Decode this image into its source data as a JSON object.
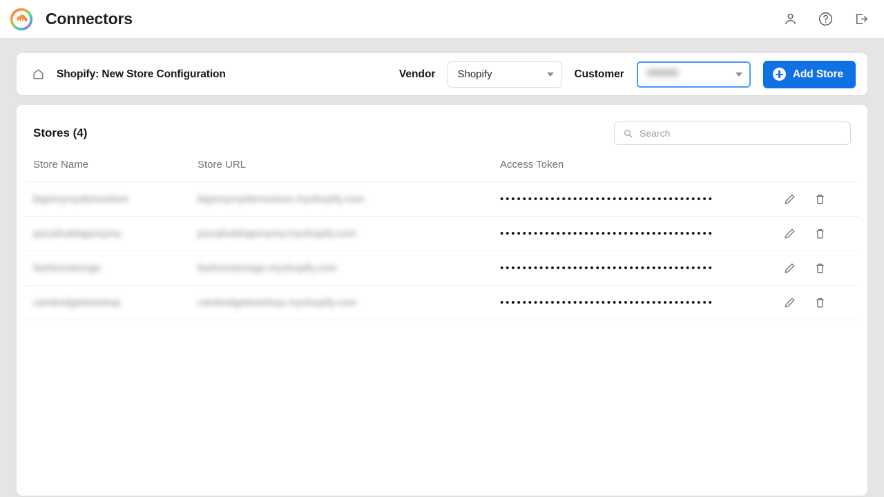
{
  "header": {
    "app_title": "Connectors",
    "logo_icon": "cloud-bar-chart-logo",
    "actions": [
      {
        "name": "account-icon",
        "label": "Account"
      },
      {
        "name": "help-icon",
        "label": "Help"
      },
      {
        "name": "logout-icon",
        "label": "Log out"
      }
    ]
  },
  "toolbar": {
    "home_icon": "home-icon",
    "config_title": "Shopify: New Store Configuration",
    "vendor_label": "Vendor",
    "vendor_value": "Shopify",
    "customer_label": "Customer",
    "customer_value": "default",
    "customer_focused": true,
    "add_store_label": "Add Store",
    "add_button_color": "#1071e5"
  },
  "stores": {
    "title": "Stores (4)",
    "count": 4,
    "search": {
      "placeholder": "Search",
      "value": "",
      "icon": "search-icon"
    },
    "columns": [
      "Store Name",
      "Store URL",
      "Access Token",
      ""
    ],
    "token_mask": "••••••••••••••••••••••••••••••••••••••",
    "rows": [
      {
        "store_name": "bigsmymydemostore",
        "store_url": "bigsmymydemostore.myshopify.com",
        "access_token": "••••••••••••••••••••••••••••••••••••••",
        "redacted": true
      },
      {
        "store_name": "pizzahubbigsmymy",
        "store_url": "pizzahubbigsmymy.myshopify.com",
        "access_token": "••••••••••••••••••••••••••••••••••••••",
        "redacted": true
      },
      {
        "store_name": "fashionstorego",
        "store_url": "fashionstorego.myshopify.com",
        "access_token": "••••••••••••••••••••••••••••••••••••••",
        "redacted": true
      },
      {
        "store_name": "cambridgetestshop",
        "store_url": "cambridgetestshop.myshopify.com",
        "access_token": "••••••••••••••••••••••••••••••••••••••",
        "redacted": true
      }
    ],
    "row_actions": [
      {
        "name": "edit-icon",
        "label": "Edit"
      },
      {
        "name": "delete-icon",
        "label": "Delete"
      }
    ]
  }
}
